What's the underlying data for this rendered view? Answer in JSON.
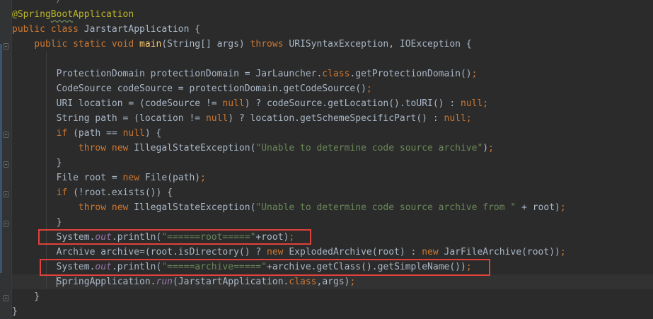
{
  "editor": {
    "language": "java",
    "theme": "darcula",
    "colors": {
      "background": "#2b2b2b",
      "gutter": "#313335",
      "keyword": "#cc7832",
      "string": "#6a8759",
      "annotation": "#bbb529",
      "method_decl": "#ffc66d",
      "static_member": "#9876aa",
      "default_text": "#a9b7c6",
      "highlight_box": "#e0413b"
    },
    "lines": [
      {
        "text": " */"
      },
      {
        "text": "@SpringBootApplication"
      },
      {
        "text": "public class JarstartApplication {"
      },
      {
        "text": "    public static void main(String[] args) throws URISyntaxException, IOException {"
      },
      {
        "text": ""
      },
      {
        "text": "        ProtectionDomain protectionDomain = JarLauncher.class.getProtectionDomain();"
      },
      {
        "text": "        CodeSource codeSource = protectionDomain.getCodeSource();"
      },
      {
        "text": "        URI location = (codeSource != null) ? codeSource.getLocation().toURI() : null;"
      },
      {
        "text": "        String path = (location != null) ? location.getSchemeSpecificPart() : null;"
      },
      {
        "text": "        if (path == null) {"
      },
      {
        "text": "            throw new IllegalStateException(\"Unable to determine code source archive\");"
      },
      {
        "text": "        }"
      },
      {
        "text": "        File root = new File(path);"
      },
      {
        "text": "        if (!root.exists()) {"
      },
      {
        "text": "            throw new IllegalStateException(\"Unable to determine code source archive from \" + root);"
      },
      {
        "text": "        }"
      },
      {
        "text": "        System.out.println(\"======root=====\"+root);"
      },
      {
        "text": "        Archive archive=(root.isDirectory() ? new ExplodedArchive(root) : new JarFileArchive(root));"
      },
      {
        "text": "        System.out.println(\"=====archive=====\"+archive.getClass().getSimpleName());"
      },
      {
        "text": "        SpringApplication.run(JarstartApplication.class,args);"
      },
      {
        "text": "    }"
      },
      {
        "text": "}"
      }
    ],
    "highlighted_lines": [
      17,
      19
    ],
    "current_line": 20
  }
}
